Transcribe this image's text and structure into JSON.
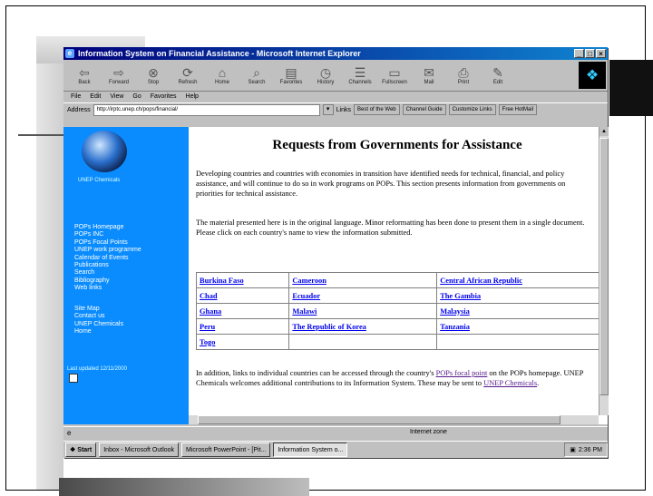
{
  "window": {
    "title": "Information System on Financial Assistance - Microsoft Internet Explorer",
    "buttons": [
      "_",
      "□",
      "×"
    ]
  },
  "toolbar": {
    "buttons": [
      {
        "label": "Back",
        "icon": "back-arrow-icon"
      },
      {
        "label": "Forward",
        "icon": "forward-arrow-icon"
      },
      {
        "label": "Stop",
        "icon": "stop-icon"
      },
      {
        "label": "Refresh",
        "icon": "refresh-icon"
      },
      {
        "label": "Home",
        "icon": "home-icon"
      },
      {
        "label": "Search",
        "icon": "search-icon"
      },
      {
        "label": "Favorites",
        "icon": "favorites-icon"
      },
      {
        "label": "History",
        "icon": "history-icon"
      },
      {
        "label": "Channels",
        "icon": "channels-icon"
      },
      {
        "label": "Fullscreen",
        "icon": "fullscreen-icon"
      },
      {
        "label": "Mail",
        "icon": "mail-icon"
      },
      {
        "label": "Print",
        "icon": "print-icon"
      },
      {
        "label": "Edit",
        "icon": "edit-icon"
      }
    ]
  },
  "menu": [
    "File",
    "Edit",
    "View",
    "Go",
    "Favorites",
    "Help"
  ],
  "address": {
    "label": "Address",
    "url": "http://irptc.unep.ch/pops/financial/",
    "links_label": "Links",
    "links": [
      "Best of the Web",
      "Channel Guide",
      "Customize Links",
      "Free HotMail"
    ]
  },
  "sidebar": {
    "tagline": "UNEP Chemicals",
    "menu1": [
      "POPs Homepage",
      "POPs INC",
      "POPs Focal Points",
      "UNEP work programme",
      "Calendar of Events",
      "Publications",
      "Search",
      "Bibliography",
      "Web links"
    ],
    "menu2": [
      "Site Map",
      "Contact us",
      "UNEP Chemicals",
      "Home"
    ],
    "updated": "Last updated 12/11/2000"
  },
  "main": {
    "heading": "Requests from Governments for Assistance",
    "p1": "Developing countries and countries with economies in transition have identified needs for technical, financial, and policy assistance, and will continue to do so in work programs on POPs. This section presents information from governments on priorities for technical assistance.",
    "p2": "The material presented here is in the original language. Minor reformatting has been done to present them in a single document. Please click on each country's name to view the information submitted.",
    "countries": [
      [
        "Burkina Faso",
        "Cameroon",
        "Central African Republic"
      ],
      [
        "Chad",
        "Ecuador",
        "The Gambia"
      ],
      [
        "Ghana",
        "Malawi",
        "Malaysia"
      ],
      [
        "Peru",
        "The Republic of Korea",
        "Tanzania"
      ],
      [
        "Togo",
        "",
        ""
      ]
    ],
    "p3_pre": "In addition, links to individual countries can be accessed through the country's ",
    "p3_link": "POPs focal point",
    "p3_mid": " on the POPs homepage. UNEP Chemicals welcomes additional contributions to its Information System. These may be sent to ",
    "p3_link2": "UNEP Chemicals",
    "p3_end": "."
  },
  "statusbar": {
    "zone": "Internet zone"
  },
  "taskbar": {
    "start": "Start",
    "tasks": [
      "Inbox - Microsoft Outlook",
      "Microsoft PowerPoint - [Pit...",
      "Information System o..."
    ],
    "time": "2:36 PM"
  }
}
